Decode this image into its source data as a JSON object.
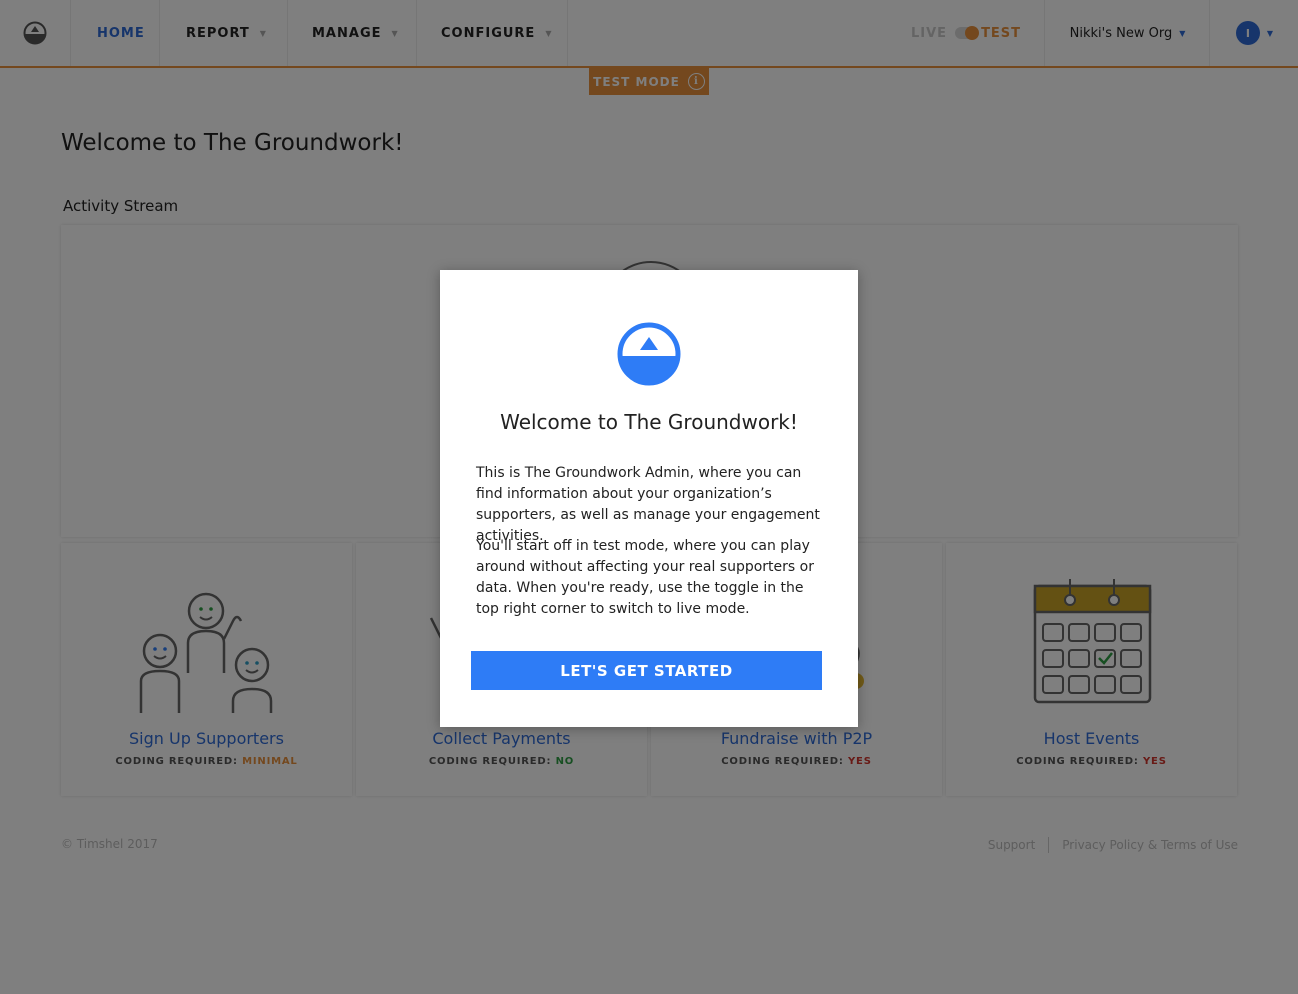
{
  "header": {
    "logo_icon": "groundwork-logo-icon",
    "nav": [
      {
        "label": "HOME"
      },
      {
        "label": "REPORT"
      },
      {
        "label": "MANAGE"
      },
      {
        "label": "CONFIGURE"
      }
    ],
    "mode": {
      "live_label": "LIVE",
      "test_label": "TEST",
      "selected": "TEST"
    },
    "org_name": "Nikki's New Org",
    "user_initial": "I",
    "test_badge": "TEST MODE"
  },
  "page": {
    "title": "Welcome to The Groundwork!",
    "activity_label": "Activity Stream"
  },
  "cards": [
    {
      "title": "Sign Up Supporters",
      "coding_label": "CODING REQUIRED:",
      "coding_value": "MINIMAL",
      "coding_color": "#e8913c"
    },
    {
      "title": "Collect Payments",
      "coding_label": "CODING REQUIRED:",
      "coding_value": "NO",
      "coding_color": "#2f9e44"
    },
    {
      "title": "Fundraise with P2P",
      "coding_label": "CODING REQUIRED:",
      "coding_value": "YES",
      "coding_color": "#d0342c"
    },
    {
      "title": "Host Events",
      "coding_label": "CODING REQUIRED:",
      "coding_value": "YES",
      "coding_color": "#d0342c"
    }
  ],
  "footer": {
    "copyright": "© Timshel 2017",
    "support": "Support",
    "privacy": "Privacy Policy & Terms of Use"
  },
  "modal": {
    "title": "Welcome to The Groundwork!",
    "paragraph1": "This is The Groundwork Admin, where you can find information about your organization’s supporters, as well as manage your engagement activities.",
    "paragraph2": "You'll start off in test mode, where you can play around without affecting your real supporters or data. When you're ready, use the toggle in the top right corner to switch to live mode.",
    "button": "LET'S GET STARTED"
  },
  "colors": {
    "accent_blue": "#2e7cf6",
    "test_orange": "#e8913c",
    "calendar_gold": "#c9a227"
  }
}
